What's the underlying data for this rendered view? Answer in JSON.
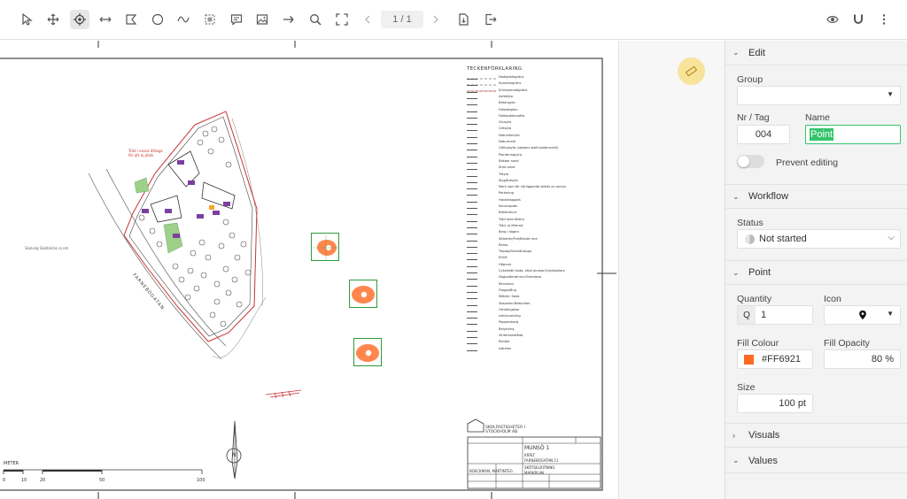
{
  "toolbar": {
    "tools": [
      {
        "name": "select-tool-button",
        "icon": "cursor-arrow-icon"
      },
      {
        "name": "pan-tool-button",
        "icon": "move-arrows-icon"
      },
      {
        "name": "point-tool-button",
        "icon": "target-icon"
      },
      {
        "name": "measure-tool-button",
        "icon": "double-arrow-icon"
      },
      {
        "name": "polygon-tool-button",
        "icon": "polygon-icon"
      },
      {
        "name": "ellipse-tool-button",
        "icon": "circle-icon"
      },
      {
        "name": "freehand-tool-button",
        "icon": "wave-icon"
      },
      {
        "name": "area-tool-button",
        "icon": "dashed-square-icon"
      },
      {
        "name": "comment-tool-button",
        "icon": "speech-bubble-icon"
      },
      {
        "name": "image-tool-button",
        "icon": "image-icon"
      },
      {
        "name": "arrow-tool-button",
        "icon": "arrow-right-icon"
      },
      {
        "name": "zoom-tool-button",
        "icon": "magnifier-icon"
      },
      {
        "name": "fit-screen-button",
        "icon": "expand-corners-icon"
      }
    ],
    "page_indicator": "1 / 1"
  },
  "drawing": {
    "legend_title": "TECKENFÖRKLARING",
    "legend_items": [
      "Fastighetsgräns",
      "Kvartersgräns",
      "Entreprenadgräns",
      "Asfaltyta",
      "Betongyta",
      "Fotbollsplan",
      "Fallskyddsmatta",
      "Grusyta",
      "Gräsyta",
      "Naturstenyta",
      "Naturmark",
      "Odlingsyta (skolans skolhusdomsvell)",
      "Planteringsyta",
      "Bakbar sand",
      "Strid sand",
      "Träyta",
      "Ätygårdsyta",
      "Mark som för närliggande skötts av annan",
      "Parkering",
      "Handikappats",
      "Servicepats",
      "Klätterdunt",
      "Träd med ättera",
      "Träd, ej ifiterad",
      "Berg i dagen",
      "Sittdeler/Frei/Bende mur",
      "Ramp",
      "Trappa/Strandtrappa",
      "Entré",
      "Häpned",
      "Cykelställ fasta, ettal plutsar/Cykelpollare",
      "Dagvattenbrunn/Grendena",
      "Rännsten",
      "Flaggstång",
      "Möbler, fasta",
      "Skapston/Naturston",
      "Utrotlingsbar",
      "Lekutrustning",
      "Papperskorg",
      "Belysning",
      "Vintersandlåda",
      "Rondie",
      "Isdrelas"
    ],
    "street_label": "FARNEBOGATAN",
    "side_street_label": "Skolväg Skolbäcke ej om",
    "note_text": "Träd i vessa ätilaga för att ej plats",
    "company_name": "SKOLFASTIGHETER I STOCKHOLM AB",
    "project_title": "MUNSÖ 1",
    "project_sub1": "KRÄLT",
    "project_sub2": "FARNEBOGATAN 11",
    "drawing_type": "SKÖTSELRITNING",
    "drawing_type_sub": "MARKPLAN",
    "signer": "BOECKMAN, MARTINTEG",
    "scale_title": "METER",
    "scale_ticks": [
      "0",
      "10",
      "20",
      "50",
      "100"
    ],
    "north_label": "N"
  },
  "panel": {
    "edit_header": "Edit",
    "group_label": "Group",
    "group_value": "",
    "nr_label": "Nr / Tag",
    "nr_value": "004",
    "name_label": "Name",
    "name_value": "Point",
    "prevent_label": "Prevent editing",
    "workflow_header": "Workflow",
    "status_label": "Status",
    "status_value": "Not started",
    "point_header": "Point",
    "quantity_label": "Quantity",
    "quantity_prefix": "Q",
    "quantity_value": "1",
    "icon_label": "Icon",
    "fill_colour_label": "Fill Colour",
    "fill_colour_value": "#FF6921",
    "fill_opacity_label": "Fill Opacity",
    "fill_opacity_value": "80 %",
    "size_label": "Size",
    "size_value": "100 pt",
    "visuals_header": "Visuals",
    "values_header": "Values"
  },
  "colors": {
    "accent_green": "#2e9b3a",
    "marker_orange": "#FF6921",
    "selection_green_bg": "#35c46b",
    "ruler_badge": "#f7e39a"
  }
}
